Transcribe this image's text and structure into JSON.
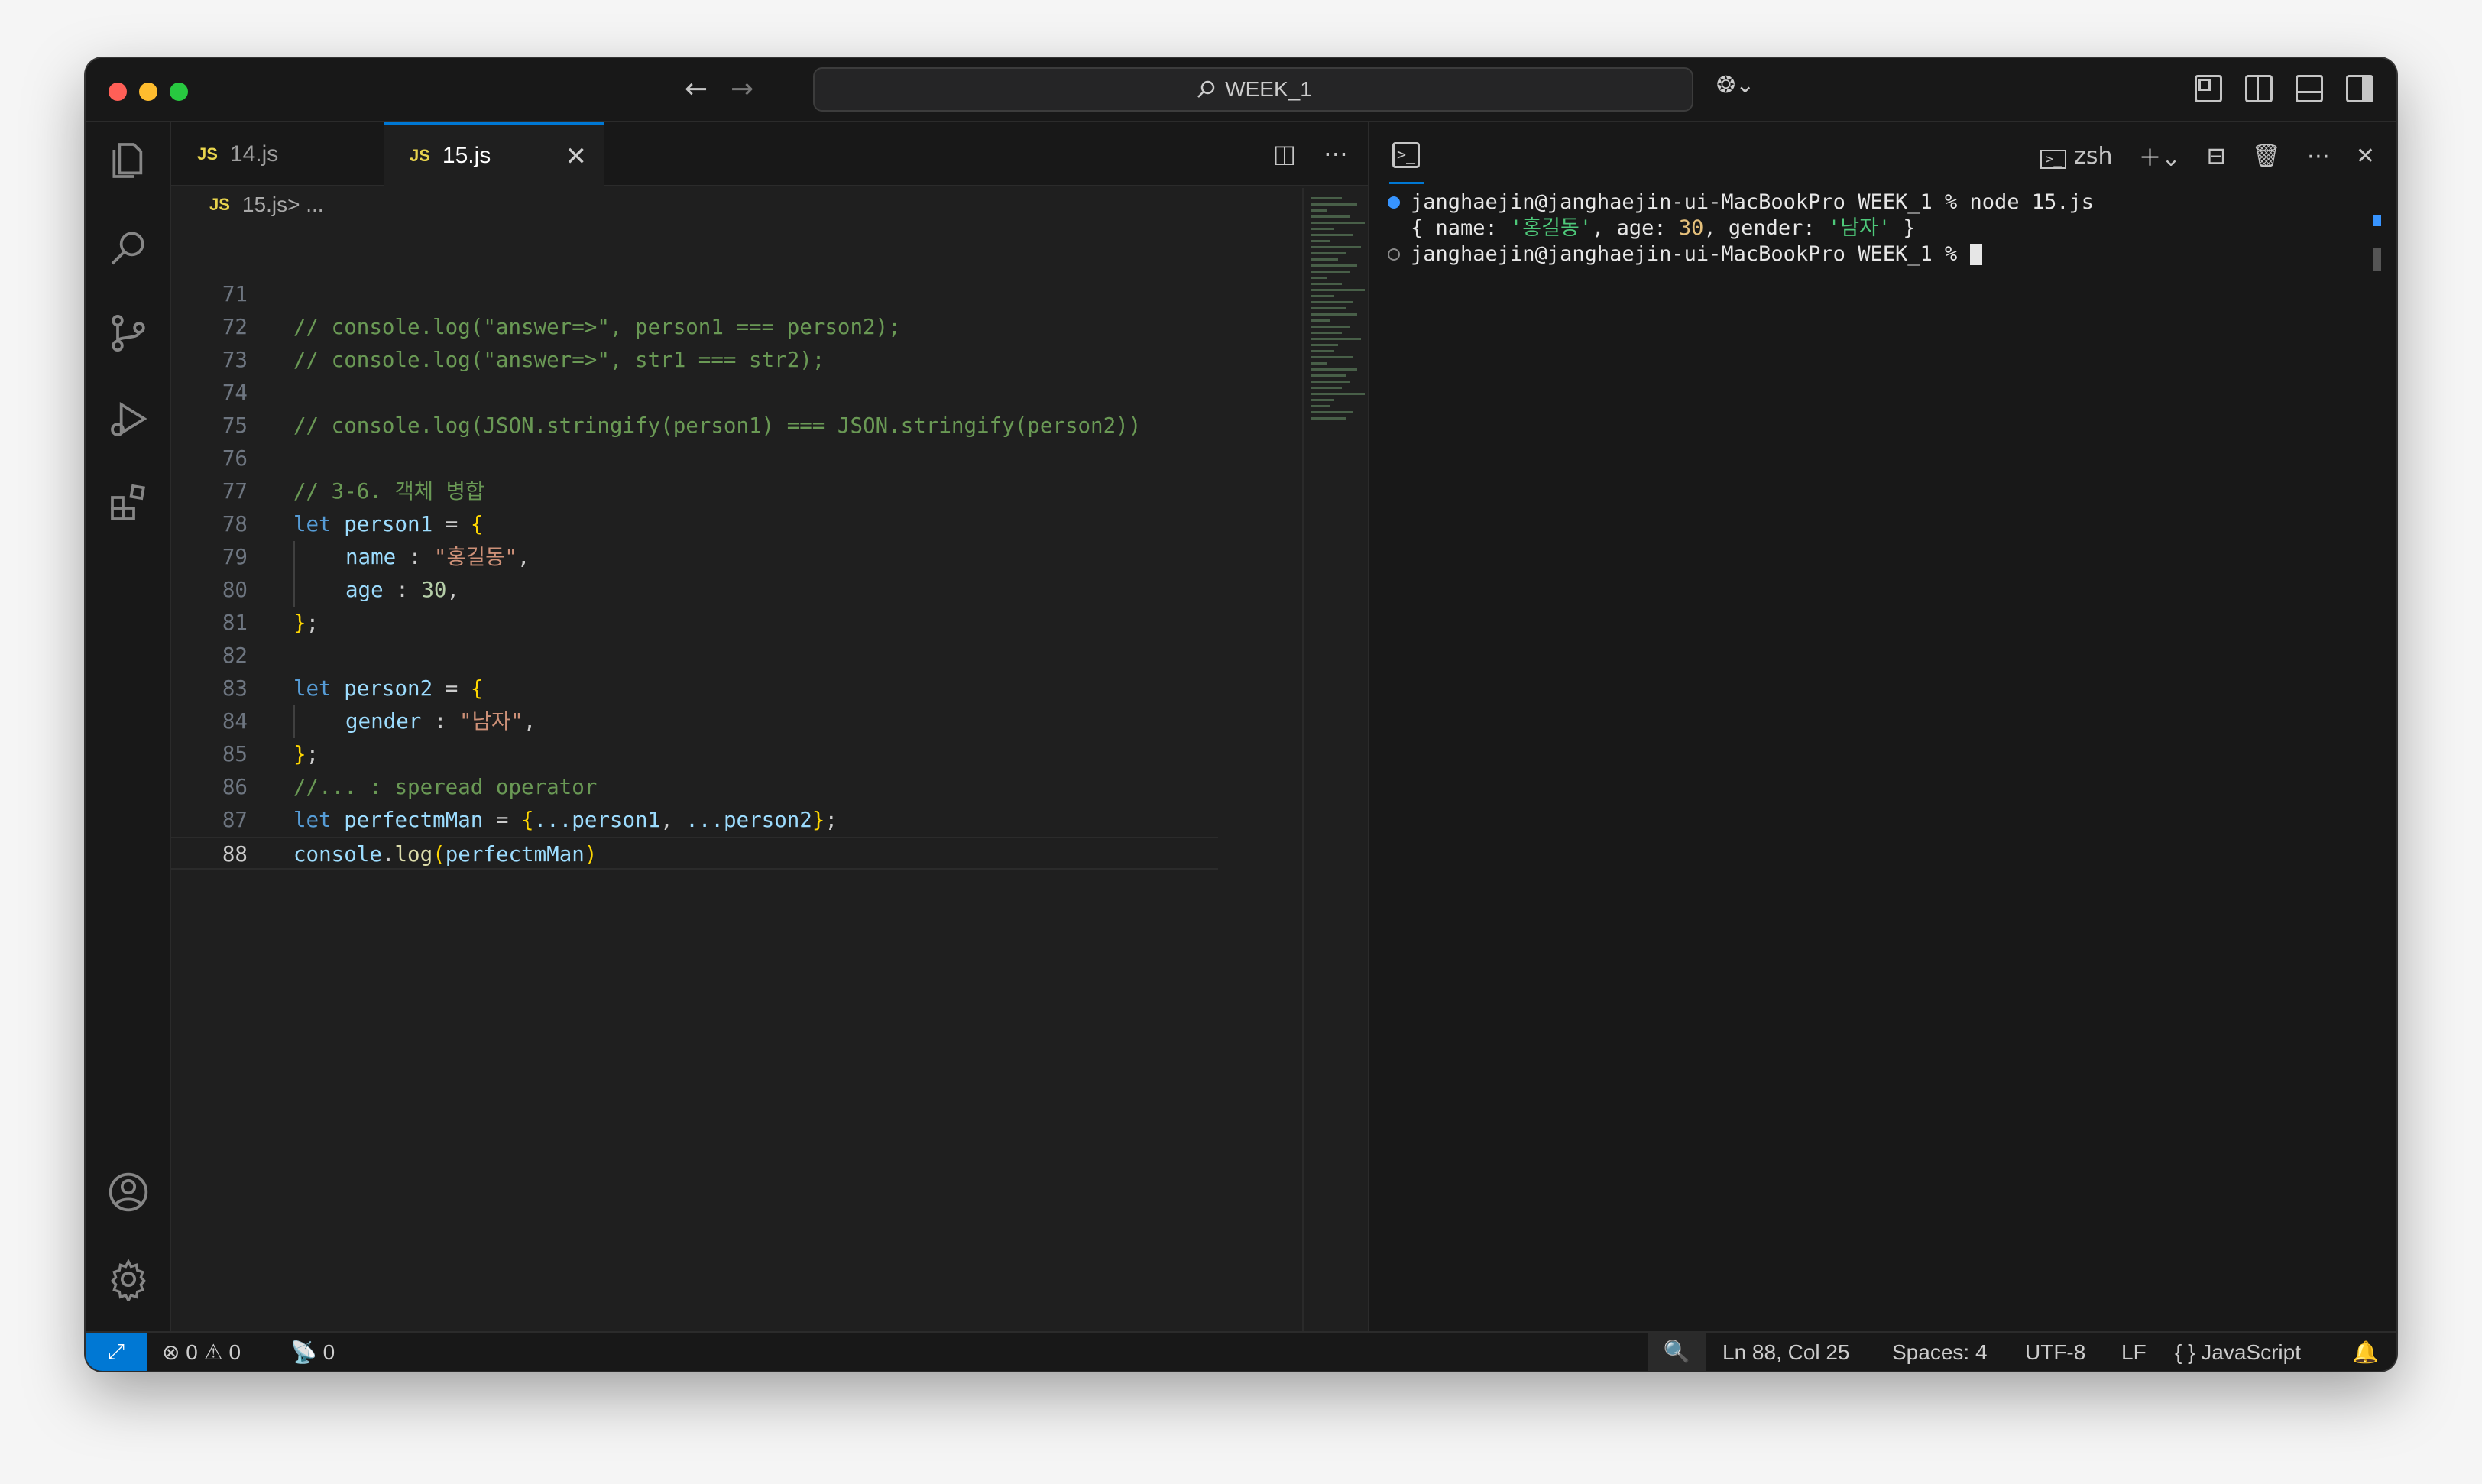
{
  "window": {
    "search_text": "WEEK_1",
    "back_glyph": "←",
    "forward_glyph": "→",
    "copilot_glyph": "❂⌄"
  },
  "tabs": [
    {
      "label": "14.js",
      "badge": "JS",
      "active": false
    },
    {
      "label": "15.js",
      "badge": "JS",
      "active": true
    }
  ],
  "breadcrumb": {
    "file": "15.js",
    "badge": "JS",
    "rest": " > ..."
  },
  "code_lines": [
    {
      "num": "71"
    },
    {
      "num": "72",
      "text": "// console.log(\"answer=>\", person1 === person2);"
    },
    {
      "num": "73",
      "text": "// console.log(\"answer=>\", str1 === str2);"
    },
    {
      "num": "74"
    },
    {
      "num": "75",
      "text": "// console.log(JSON.stringify(person1) === JSON.stringify(person2))"
    },
    {
      "num": "76"
    },
    {
      "num": "77",
      "text": "// 3-6. 객체 병합"
    },
    {
      "num": "78",
      "kw": "let",
      "var": "person1",
      "op": " = ",
      "brace": "{"
    },
    {
      "num": "79",
      "var": "name",
      "op": " : ",
      "str": "\"홍길동\"",
      "end": ","
    },
    {
      "num": "80",
      "var": "age",
      "op": " : ",
      "num_val": "30",
      "end": ","
    },
    {
      "num": "81",
      "brace": "}",
      "end": ";"
    },
    {
      "num": "82"
    },
    {
      "num": "83",
      "kw": "let",
      "var": "person2",
      "op": " = ",
      "brace": "{"
    },
    {
      "num": "84",
      "var": "gender",
      "op": " : ",
      "str": "\"남자\"",
      "end": ","
    },
    {
      "num": "85",
      "brace": "}",
      "end": ";"
    },
    {
      "num": "86",
      "text": "//... : speread operator"
    },
    {
      "num": "87",
      "kw": "let",
      "var": "perfectmMan",
      "op": " = ",
      "brace": "{",
      "spread1": "...person1",
      "sep": ", ",
      "spread2": "...person2",
      "brace2": "}",
      "end": ";"
    },
    {
      "num": "88",
      "obj": "console",
      "dot": ".",
      "fn": "log",
      "paren": "(",
      "arg": "perfectmMan",
      "paren2": ")"
    }
  ],
  "terminal": {
    "shell": "zsh",
    "line1": "janghaejin@janghaejin-ui-MacBookPro WEEK_1 % node 15.js",
    "line2_parts": {
      "open": "{ name: ",
      "name": "'홍길동'",
      "age_label": ", age: ",
      "age": "30",
      "gender_label": ", gender: ",
      "gender": "'남자'",
      "close": " }"
    },
    "line3": "janghaejin@janghaejin-ui-MacBookPro WEEK_1 % "
  },
  "status": {
    "errors": "0",
    "warnings": "0",
    "ports": "0",
    "position": "Ln 88, Col 25",
    "spaces": "Spaces: 4",
    "encoding": "UTF-8",
    "eol": "LF",
    "language": "JavaScript",
    "language_icon": "{ }"
  },
  "colors": {
    "accent": "#0078d4",
    "comment": "#6a9955",
    "keyword": "#569cd6",
    "string": "#ce9178"
  }
}
